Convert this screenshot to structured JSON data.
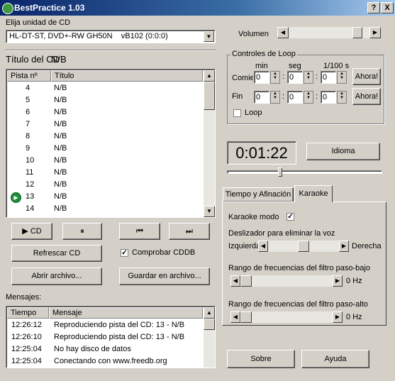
{
  "window": {
    "title": "BestPractice 1.03",
    "help_btn": "?",
    "close_btn": "X"
  },
  "cd": {
    "label": "Elija unidad de CD",
    "drive": "HL-DT-ST, DVD+-RW GH50N    vB102 (0:0:0)",
    "title_label": "Título del CD",
    "title_value": "N/B"
  },
  "tracks": {
    "col_track": "Pista nº",
    "col_title": "Título",
    "rows": [
      {
        "n": "4",
        "t": "N/B"
      },
      {
        "n": "5",
        "t": "N/B"
      },
      {
        "n": "6",
        "t": "N/B"
      },
      {
        "n": "7",
        "t": "N/B"
      },
      {
        "n": "8",
        "t": "N/B"
      },
      {
        "n": "9",
        "t": "N/B"
      },
      {
        "n": "10",
        "t": "N/B"
      },
      {
        "n": "11",
        "t": "N/B"
      },
      {
        "n": "12",
        "t": "N/B"
      },
      {
        "n": "13",
        "t": "N/B"
      },
      {
        "n": "14",
        "t": "N/B"
      }
    ],
    "playing_index": 9
  },
  "transport": {
    "play": "▶ CD",
    "pause": "⏸",
    "prev": "⏮",
    "next": "⏭"
  },
  "buttons": {
    "refresh": "Refrescar CD",
    "check_cddb": "Comprobar CDDB",
    "open": "Abrir archivo...",
    "save": "Guardar en archivo...",
    "about": "Sobre",
    "help": "Ayuda",
    "language": "Idioma"
  },
  "messages": {
    "label": "Mensajes:",
    "col_time": "Tiempo",
    "col_msg": "Mensaje",
    "rows": [
      {
        "t": "12:26:12",
        "m": "Reproduciendo pista del CD: 13 - N/B"
      },
      {
        "t": "12:26:10",
        "m": "Reproduciendo pista del CD: 13 - N/B"
      },
      {
        "t": "12:25:04",
        "m": "No hay disco de datos"
      },
      {
        "t": "12:25:04",
        "m": "Conectando con www.freedb.org"
      }
    ]
  },
  "volume": {
    "label": "Volumen",
    "level": 0.9
  },
  "loop": {
    "legend": "Controles de Loop",
    "col_min": "min",
    "col_seg": "seg",
    "col_cent": "1/100 s",
    "start_label": "Comienzo",
    "end_label": "Fin",
    "start": {
      "min": "0",
      "seg": "0",
      "cent": "0"
    },
    "end": {
      "min": "0",
      "seg": "0",
      "cent": "0"
    },
    "now_btn": "Ahora!",
    "loop_label": "Loop"
  },
  "time_display": "0:01:22",
  "position": 0.34,
  "tabs": {
    "tab1": "Tiempo y Afinación",
    "tab2": "Karaoke"
  },
  "karaoke": {
    "mode_label": "Karaoke modo",
    "voice_label": "Deslizador para eliminar la voz",
    "left": "Izquierda",
    "right": "Derecha",
    "voice_level": 0.5,
    "low_label": "Rango de frecuencias del filtro paso-bajo",
    "low_value": "0 Hz",
    "high_label": "Rango de frecuencias del filtro paso-alto",
    "high_value": "0 Hz"
  }
}
